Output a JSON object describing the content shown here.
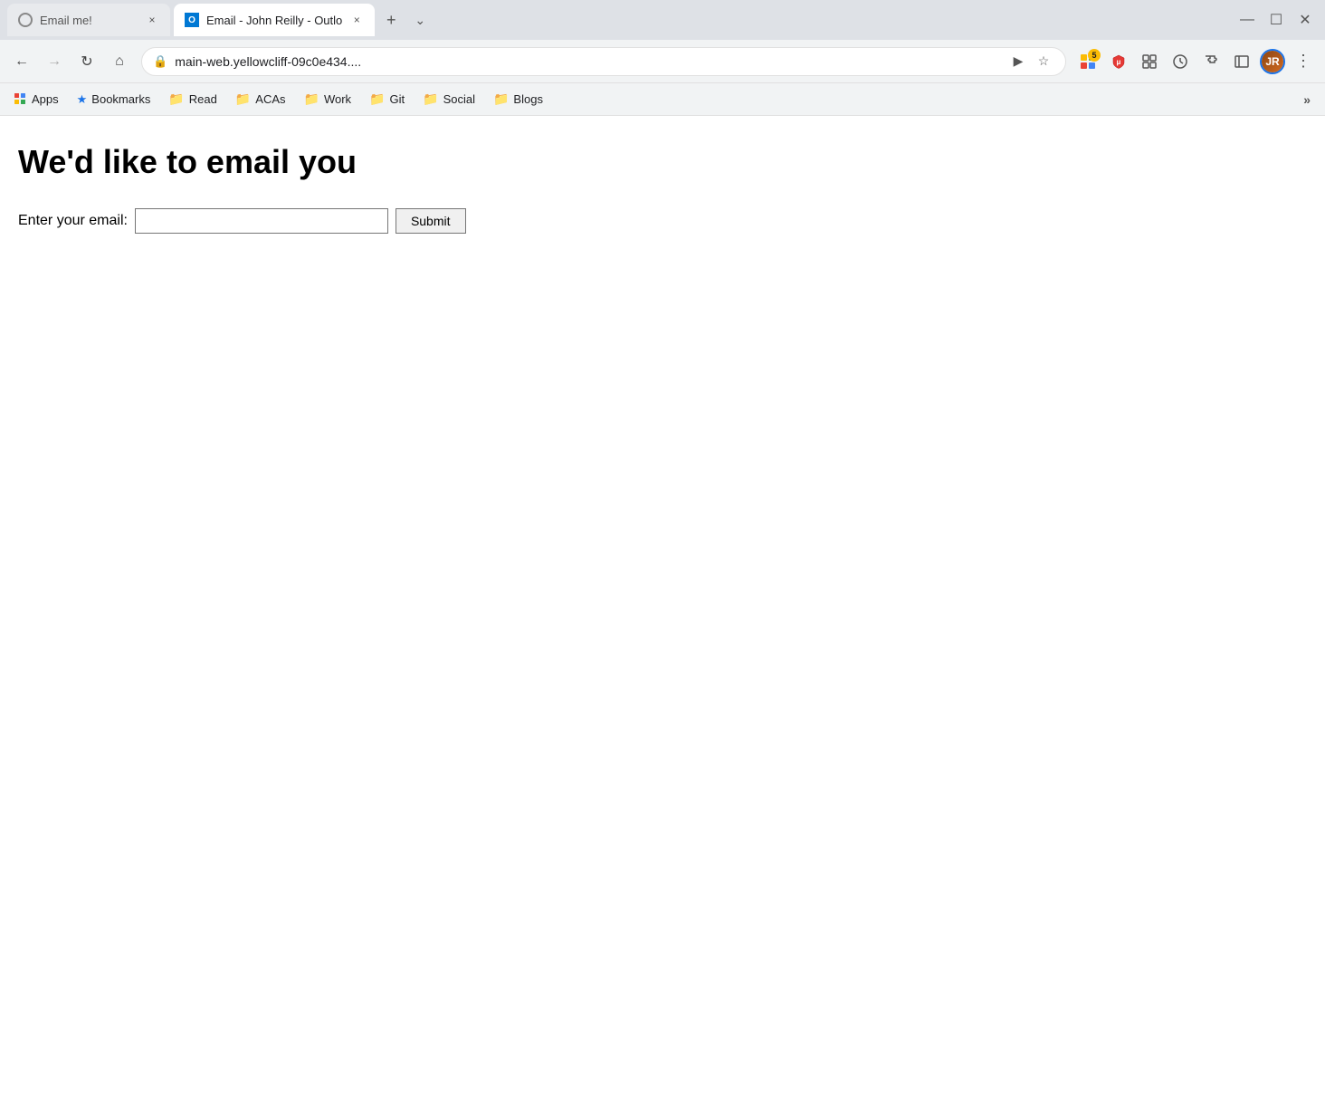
{
  "browser": {
    "tabs": [
      {
        "id": "tab-email-me",
        "title": "Email me!",
        "favicon": "globe",
        "active": false,
        "close_label": "×"
      },
      {
        "id": "tab-outlook",
        "title": "Email - John Reilly - Outlo",
        "favicon": "outlook",
        "active": true,
        "close_label": "×"
      }
    ],
    "new_tab_label": "+",
    "tab_chevron_label": "⌄",
    "window_controls": {
      "minimize": "—",
      "maximize": "☐",
      "close": "✕"
    }
  },
  "nav": {
    "back_label": "←",
    "forward_label": "→",
    "reload_label": "↻",
    "home_label": "⌂",
    "address": "main-web.yellowcliff-09c0e434....",
    "send_label": "▶",
    "star_label": "☆",
    "extensions_label": "🧩",
    "sidebar_label": "▭",
    "menu_label": "⋮"
  },
  "bookmarks": {
    "items": [
      {
        "id": "apps",
        "label": "Apps",
        "type": "apps"
      },
      {
        "id": "bookmarks",
        "label": "Bookmarks",
        "type": "folder",
        "icon": "★"
      },
      {
        "id": "read",
        "label": "Read",
        "type": "folder"
      },
      {
        "id": "acas",
        "label": "ACAs",
        "type": "folder"
      },
      {
        "id": "work",
        "label": "Work",
        "type": "folder"
      },
      {
        "id": "git",
        "label": "Git",
        "type": "folder"
      },
      {
        "id": "social",
        "label": "Social",
        "type": "folder"
      },
      {
        "id": "blogs",
        "label": "Blogs",
        "type": "folder"
      }
    ],
    "more_label": "»"
  },
  "page": {
    "heading": "We'd like to email you",
    "form": {
      "label": "Enter your email:",
      "input_placeholder": "",
      "submit_label": "Submit"
    }
  },
  "extensions": [
    {
      "id": "ext-yellow",
      "label": "Y",
      "badge": "5",
      "color": "#fbbc04"
    },
    {
      "id": "ext-shield",
      "label": "🛡",
      "badge": null
    },
    {
      "id": "ext-circle",
      "label": "⊙",
      "badge": null
    },
    {
      "id": "ext-clock",
      "label": "◎",
      "badge": null
    },
    {
      "id": "ext-puzzle",
      "label": "🧩",
      "badge": null
    }
  ]
}
